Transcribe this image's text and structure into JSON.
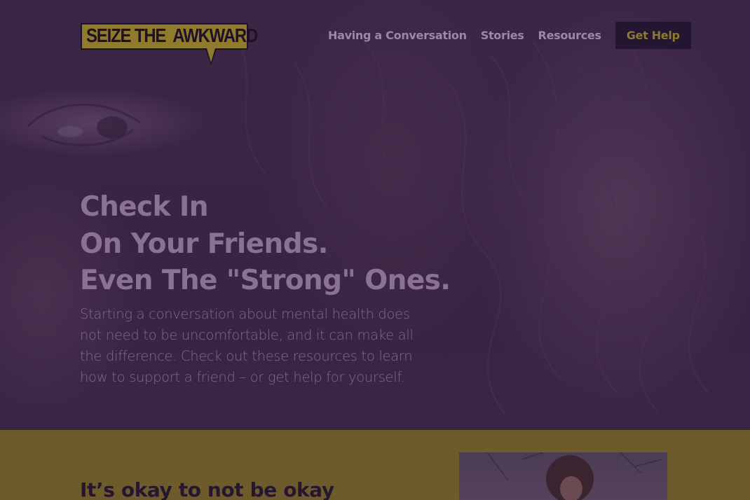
{
  "brand": {
    "logo_text": "SEIZE THE  AWKWARD"
  },
  "nav": {
    "links": [
      "Having a Conversation",
      "Stories",
      "Resources"
    ],
    "cta": "Get Help"
  },
  "hero": {
    "headline_lines": [
      "Check In",
      "On Your Friends.",
      "Even The \"Strong\" Ones."
    ],
    "subtext": "Starting a conversation about mental health does not need to be uncomfortable, and it can make all the difference. Check out these resources to learn how to support a friend – or get help for yourself."
  },
  "section": {
    "heading": "It’s okay to not be okay"
  },
  "colors": {
    "hero_overlay": "#3a2442",
    "brand_gold": "#8f7a2d",
    "band": "#6e5b2c",
    "text_muted": "#8a7294",
    "cta_bg": "#241530"
  }
}
